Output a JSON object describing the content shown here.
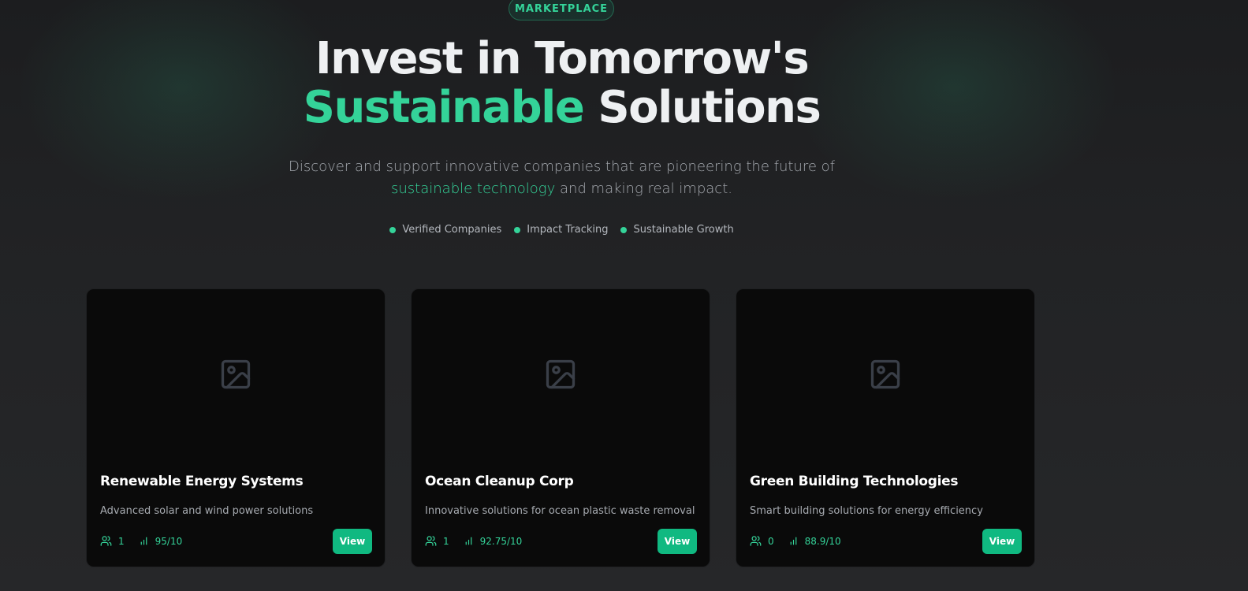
{
  "hero": {
    "badge": "MARKETPLACE",
    "title_line1": "Invest in Tomorrow's",
    "title_accent": "Sustainable",
    "title_rest": " Solutions",
    "subtitle_part1": "Discover and support innovative companies that are pioneering the future of",
    "subtitle_accent": "sustainable technology",
    "subtitle_part2": " and making real impact.",
    "features": [
      "Verified Companies",
      "Impact Tracking",
      "Sustainable Growth"
    ]
  },
  "colors": {
    "accent": "#34d399",
    "button": "#10b981",
    "card_bg": "#0a0a0a",
    "page_bg": "#222325"
  },
  "cards": [
    {
      "name": "Renewable Energy Systems",
      "description": "Advanced solar and wind power solutions",
      "investors": "1",
      "score": "95/10",
      "view_label": "View",
      "image_icon": "image-placeholder-icon"
    },
    {
      "name": "Ocean Cleanup Corp",
      "description": "Innovative solutions for ocean plastic waste removal",
      "investors": "1",
      "score": "92.75/10",
      "view_label": "View",
      "image_icon": "image-placeholder-icon"
    },
    {
      "name": "Green Building Technologies",
      "description": "Smart building solutions for energy efficiency",
      "investors": "0",
      "score": "88.9/10",
      "view_label": "View",
      "image_icon": "image-placeholder-icon"
    }
  ]
}
